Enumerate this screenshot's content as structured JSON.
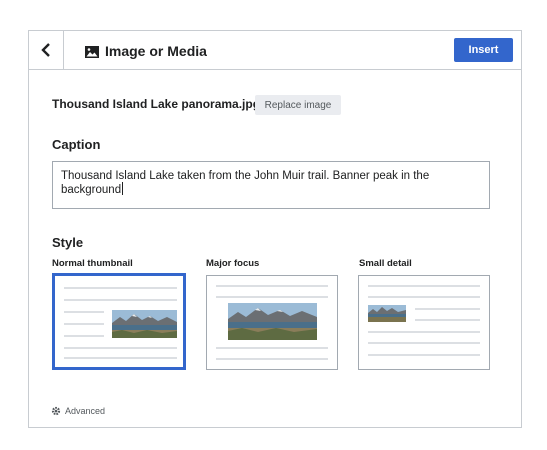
{
  "header": {
    "title": "Image or Media",
    "insert_label": "Insert"
  },
  "file": {
    "name": "Thousand Island Lake panorama.jpg",
    "replace_label": "Replace image"
  },
  "caption": {
    "label": "Caption",
    "value": "Thousand Island Lake taken from the John Muir trail. Banner peak in the background"
  },
  "style": {
    "label": "Style",
    "options": [
      {
        "label": "Normal thumbnail",
        "selected": true
      },
      {
        "label": "Major focus",
        "selected": false
      },
      {
        "label": "Small detail",
        "selected": false
      }
    ]
  },
  "advanced": {
    "label": "Advanced"
  },
  "colors": {
    "accent": "#3366cc",
    "border": "#c8ccd1",
    "placeholder_line": "#dcdfe3"
  }
}
